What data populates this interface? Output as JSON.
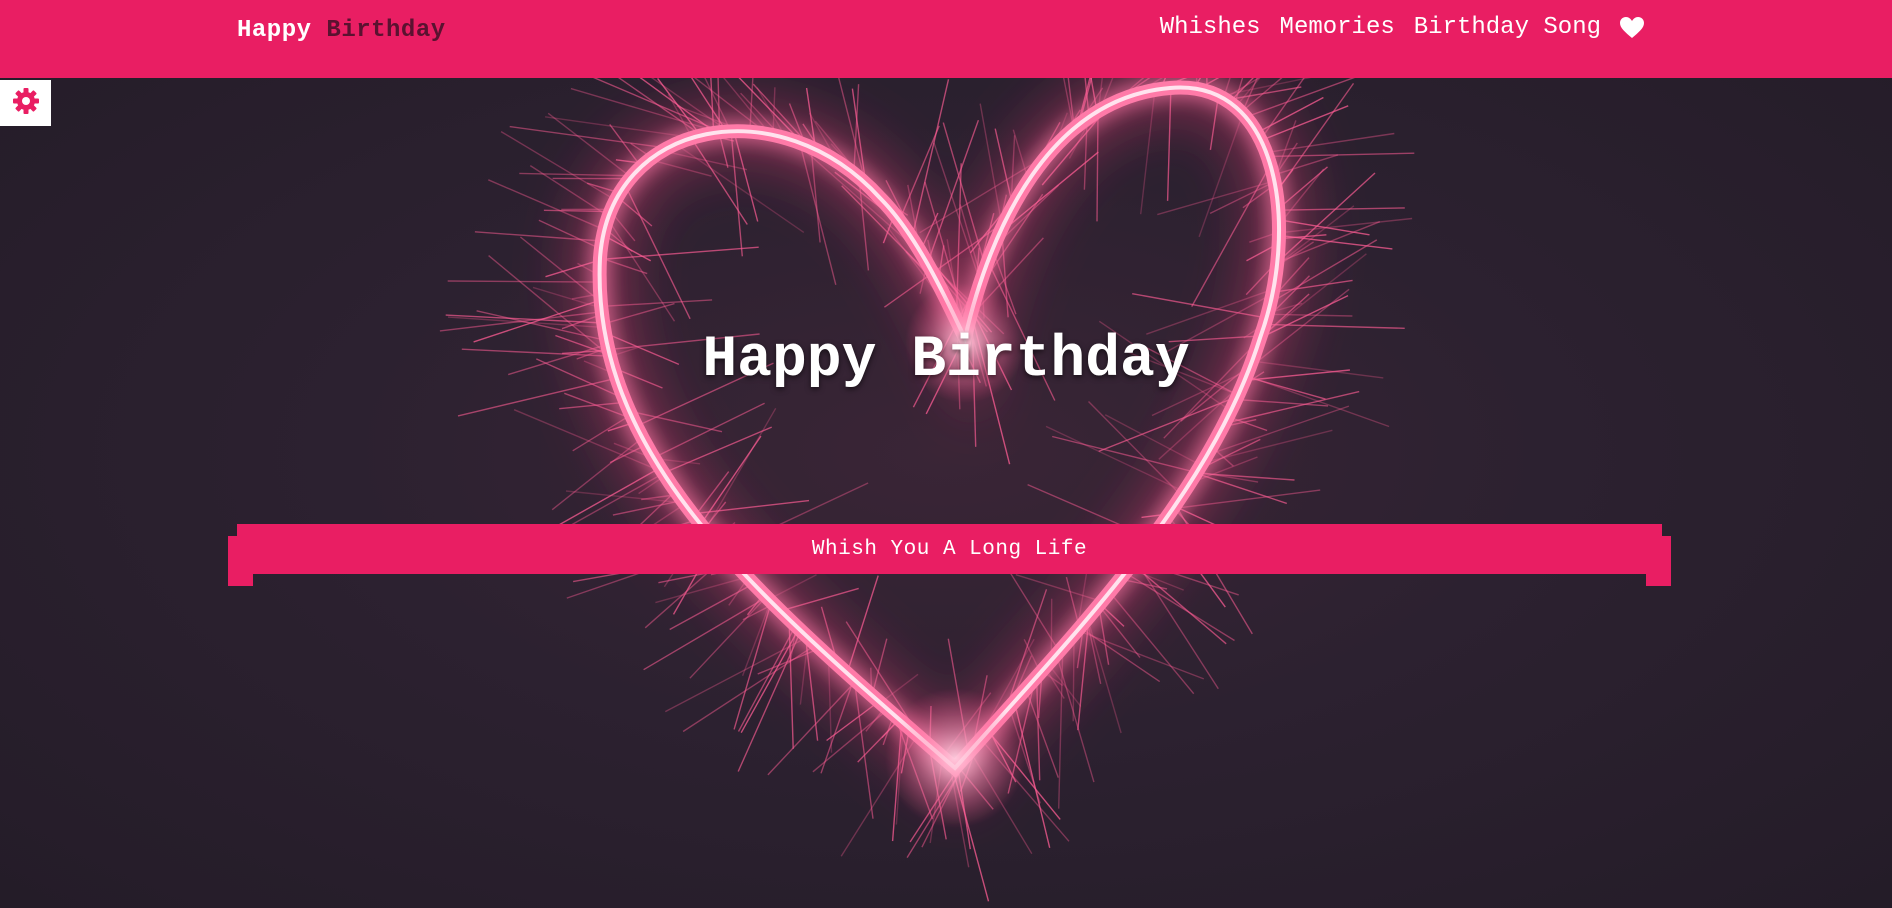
{
  "brand": {
    "part1": "Happy",
    "part2": "Birthday"
  },
  "nav": {
    "items": [
      {
        "label": "Whishes"
      },
      {
        "label": "Memories"
      },
      {
        "label": "Birthday Song"
      }
    ],
    "heart_icon": "heart-icon"
  },
  "settings": {
    "icon": "gear-icon"
  },
  "hero": {
    "title": "Happy Birthday",
    "ribbon_text": "Whish You A Long Life"
  },
  "colors": {
    "accent": "#e91e63",
    "brand_dark": "#5a1230",
    "background": "#2a1f2d",
    "text": "#ffffff"
  }
}
